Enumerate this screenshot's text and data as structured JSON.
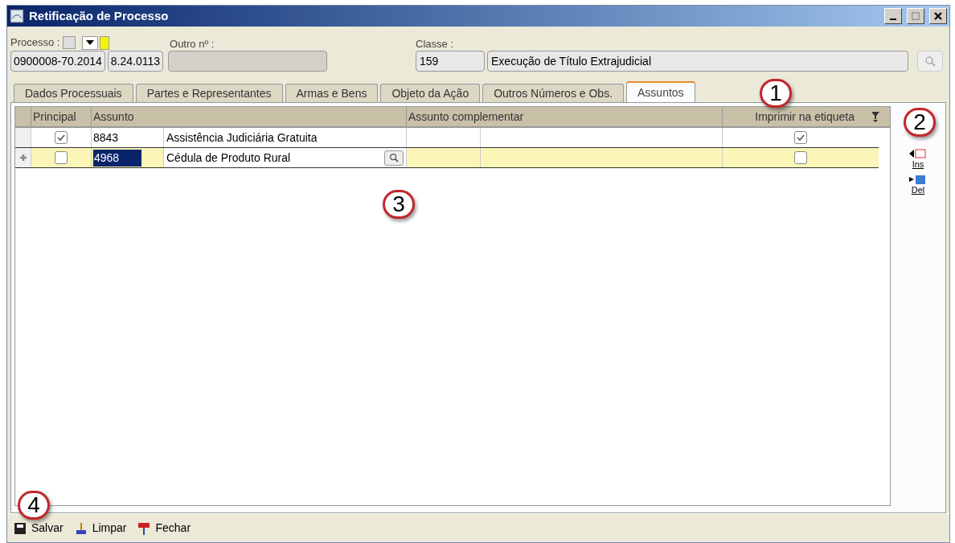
{
  "window": {
    "title": "Retificação de Processo"
  },
  "header": {
    "processo_label": "Processo :",
    "processo_number": "0900008-70.2014",
    "processo_suffix": "8.24.0113",
    "outro_label": "Outro nº :",
    "outro_value_disabled": true,
    "classe_label": "Classe :",
    "classe_code": "159",
    "classe_name": "Execução de Título Extrajudicial"
  },
  "tabs": [
    {
      "label": "Dados Processuais",
      "selected": false
    },
    {
      "label": "Partes e Representantes",
      "selected": false
    },
    {
      "label": "Armas e Bens",
      "selected": false
    },
    {
      "label": "Objeto da Ação",
      "selected": false
    },
    {
      "label": "Outros Números e Obs.",
      "selected": false
    },
    {
      "label": "Assuntos",
      "selected": true
    }
  ],
  "table": {
    "columns": [
      "Principal",
      "Assunto",
      "Assunto complementar",
      "Imprimir na etiqueta"
    ],
    "rows": [
      {
        "checked": true,
        "code": "8843",
        "name": "Assistência Judiciária Gratuita",
        "print": true,
        "selected": false
      },
      {
        "checked": false,
        "code": "4968",
        "name": "Cédula de Produto Rural",
        "print": false,
        "selected": true
      }
    ]
  },
  "side_actions": [
    "Ins",
    "Del"
  ],
  "footer": [
    "Salvar",
    "Limpar",
    "Fechar"
  ],
  "callouts": [
    "1",
    "2",
    "3",
    "4"
  ]
}
